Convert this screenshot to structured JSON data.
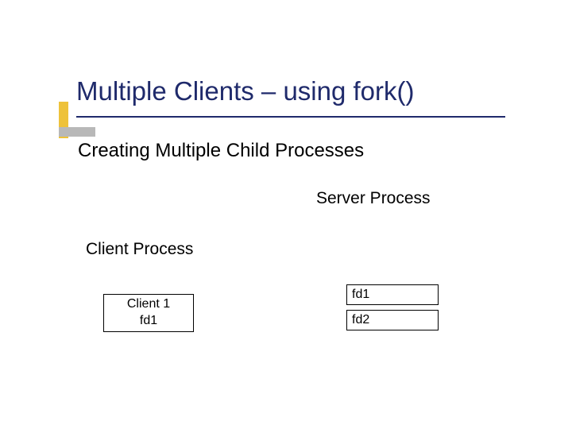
{
  "title": "Multiple Clients – using fork()",
  "subtitle": "Creating Multiple Child Processes",
  "server_label": "Server Process",
  "client_label": "Client Process",
  "client_box": {
    "line1": "Client 1",
    "line2": "fd1"
  },
  "fd_boxes": {
    "fd1": "fd1",
    "fd2": "fd2"
  }
}
